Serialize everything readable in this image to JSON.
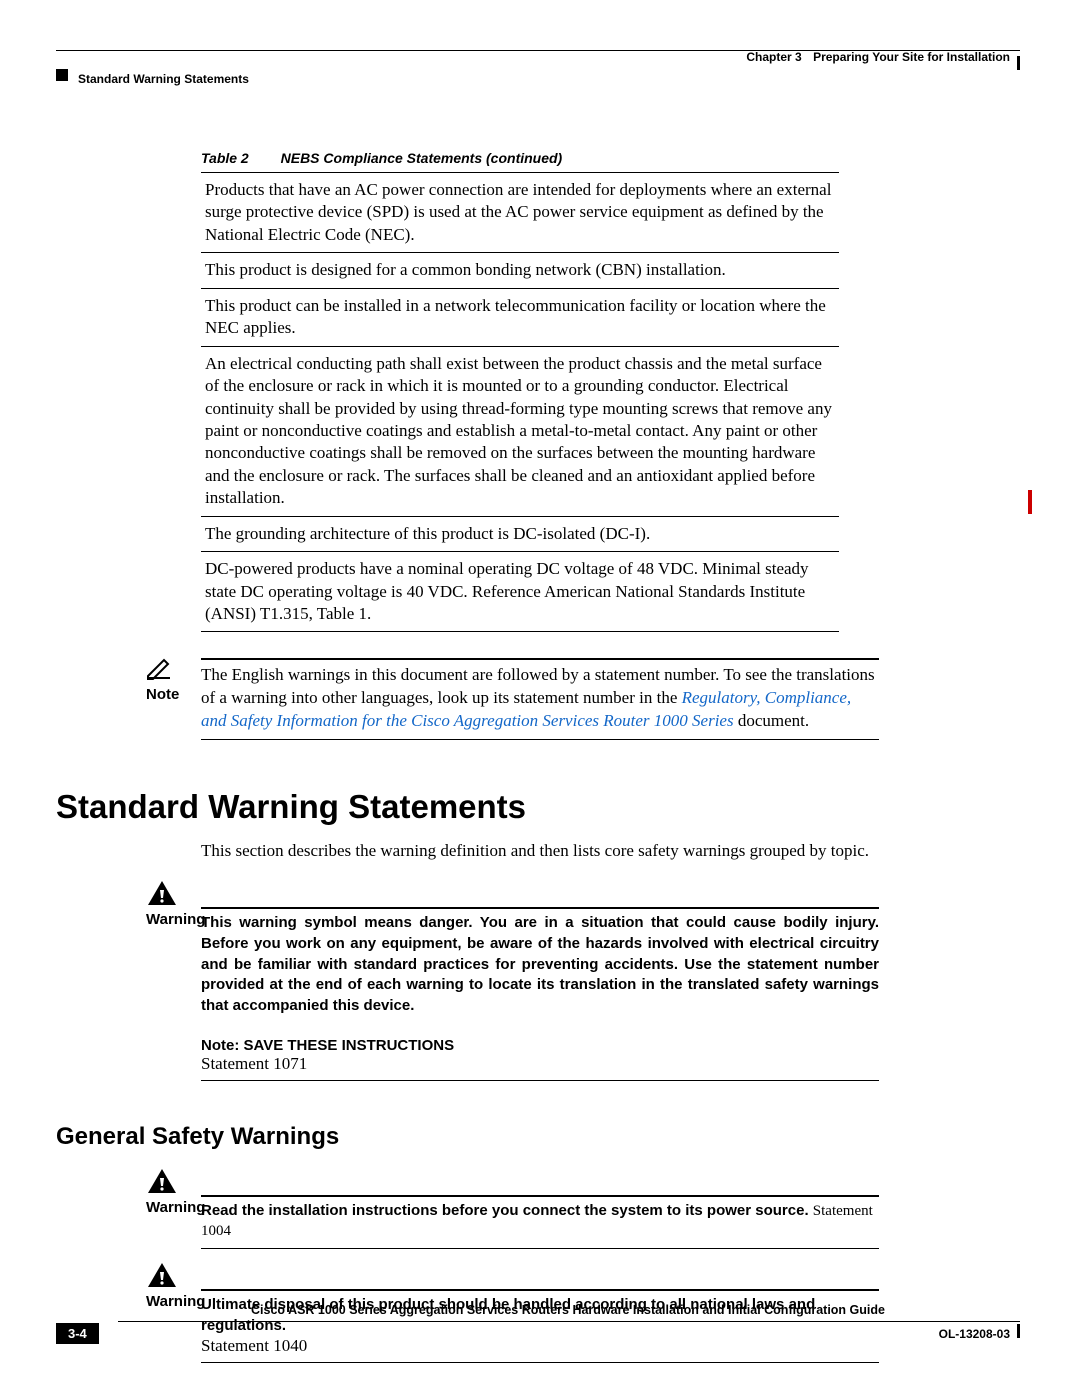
{
  "header": {
    "chapter_label": "Chapter 3",
    "chapter_title": "Preparing Your Site for Installation",
    "section_title": "Standard Warning Statements"
  },
  "table": {
    "number": "Table 2",
    "caption": "NEBS Compliance Statements (continued)",
    "rows": [
      "Products that have an AC power connection are intended for deployments where an external surge protective device (SPD) is used at the AC power service equipment as defined by the National Electric Code (NEC).",
      "This product is designed for a common bonding network (CBN) installation.",
      "This product can be installed in a network telecommunication facility or location where the NEC applies.",
      "An electrical conducting path shall exist between the product chassis and the metal surface of the enclosure or rack in which it is mounted or to a grounding conductor. Electrical continuity shall be provided by using thread-forming type mounting screws that remove any paint or nonconductive coatings and establish a metal-to-metal contact. Any paint or other nonconductive coatings shall be removed on the surfaces between the mounting hardware and the enclosure or rack. The surfaces shall be cleaned and an antioxidant applied before installation.",
      "The grounding architecture of this product is DC-isolated (DC-I).",
      "DC-powered products have a nominal operating DC voltage of 48 VDC. Minimal steady state DC operating voltage is 40 VDC. Reference American National Standards Institute (ANSI) T1.315, Table 1."
    ]
  },
  "note": {
    "label": "Note",
    "body_pre": "The English warnings in this document are followed by a statement number. To see the translations of a warning into other languages, look up its statement number in the ",
    "link_text": "Regulatory, Compliance, and Safety Information for the Cisco Aggregation Services Router 1000 Series",
    "body_post": " document."
  },
  "h1": "Standard Warning Statements",
  "h1_body": "This section describes the warning definition and then lists core safety warnings grouped by topic.",
  "warning1": {
    "label": "Warning",
    "body": "This warning symbol means danger. You are in a situation that could cause bodily injury. Before you work on any equipment, be aware of the hazards involved with electrical circuitry and be familiar with standard practices for preventing accidents. Use the statement number provided at the end of each warning to locate its translation in the translated safety warnings that accompanied this device.",
    "note": "Note: SAVE THESE INSTRUCTIONS",
    "statement": "Statement 1071"
  },
  "h2": "General Safety Warnings",
  "warning2": {
    "label": "Warning",
    "body": "Read the installation instructions before you connect the system to its power source.",
    "statement": "Statement 1004"
  },
  "warning3": {
    "label": "Warning",
    "body": "Ultimate disposal of this product should be handled according to all national laws and regulations.",
    "statement": "Statement 1040"
  },
  "footer": {
    "guide": "Cisco ASR 1000 Series Aggregation Services Routers Hardware Installation and Initial Configuration Guide",
    "page": "3-4",
    "doc": "OL-13208-03"
  }
}
